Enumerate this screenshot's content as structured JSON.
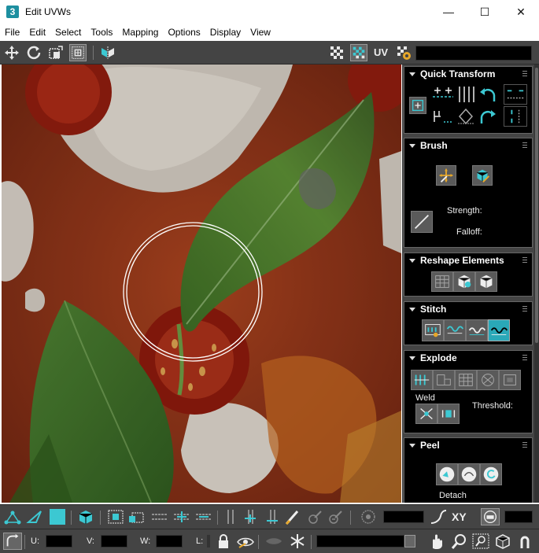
{
  "window": {
    "app_icon_text": "3",
    "title": "Edit UVWs",
    "minimize": "—",
    "maximize": "☐",
    "close": "✕"
  },
  "menu": [
    "File",
    "Edit",
    "Select",
    "Tools",
    "Mapping",
    "Options",
    "Display",
    "View"
  ],
  "toolbar": {
    "uv_label": "UV",
    "texture_dropdown_value": ""
  },
  "panels": {
    "quick_transform": {
      "title": "Quick Transform"
    },
    "brush": {
      "title": "Brush",
      "strength_label": "Strength:",
      "falloff_label": "Falloff:"
    },
    "reshape": {
      "title": "Reshape Elements"
    },
    "stitch": {
      "title": "Stitch"
    },
    "explode": {
      "title": "Explode",
      "weld_label": "Weld",
      "threshold_label": "Threshold:"
    },
    "peel": {
      "title": "Peel",
      "detach_label": "Detach"
    }
  },
  "bottom": {
    "xy_label": "XY",
    "u_label": "U:",
    "v_label": "V:",
    "w_label": "W:",
    "l_label": "L:"
  },
  "colors": {
    "toolbar_bg": "#444444",
    "panel_bg": "#000000",
    "accent_cyan": "#3cc8d2",
    "active_button": "#2aa8b8"
  }
}
